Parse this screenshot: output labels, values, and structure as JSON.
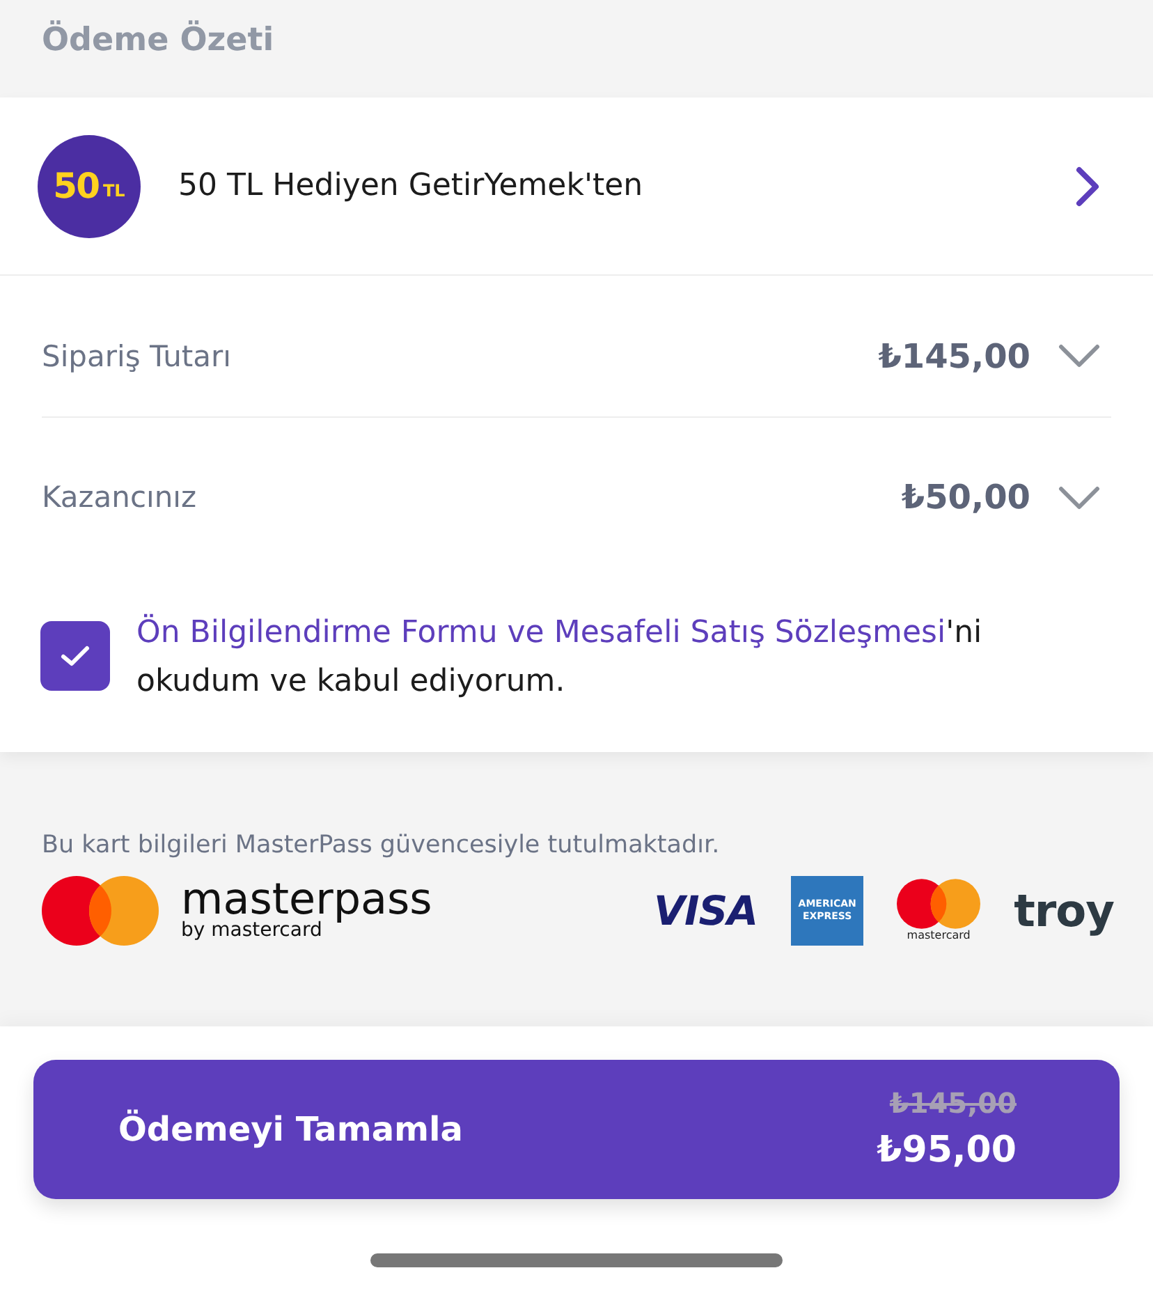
{
  "section_title": "Ödeme Özeti",
  "promo": {
    "badge_amount": "50",
    "badge_unit": "TL",
    "label": "50 TL Hediyen GetirYemek'ten"
  },
  "summary_rows": [
    {
      "label": "Sipariş Tutarı",
      "amount": "₺145,00",
      "expanded": false
    },
    {
      "label": "Kazancınız",
      "amount": "₺50,00",
      "expanded": false
    }
  ],
  "agreement": {
    "checked": true,
    "link": "Ön Bilgilendirme Formu ve Mesafeli Satış Sözleşmesi",
    "text": "'ni okudum ve kabul ediyorum."
  },
  "security_note": "Bu kart bilgileri MasterPass güvencesiyle tutulmaktadır.",
  "masterpass": {
    "wordmark": "masterpass",
    "tagline": "by mastercard"
  },
  "card_logos": [
    {
      "kind": "visa",
      "lines": [
        "VISA"
      ]
    },
    {
      "kind": "amex",
      "lines": [
        "AMERICAN",
        "EXPRESS"
      ]
    },
    {
      "kind": "mastercard",
      "lines": [
        "mastercard"
      ]
    },
    {
      "kind": "troy",
      "lines": [
        "troy"
      ]
    }
  ],
  "pay_button": {
    "label": "Ödemeyi Tamamla",
    "old_total": "₺145,00",
    "total": "₺95,00"
  }
}
